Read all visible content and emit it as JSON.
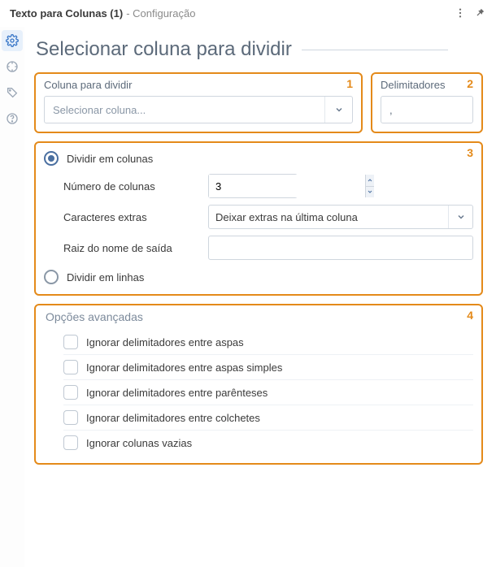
{
  "header": {
    "node_title": "Texto para Colunas (1)",
    "subtitle": "- Configuração"
  },
  "page": {
    "title": "Selecionar coluna para dividir"
  },
  "annotations": {
    "a1": "1",
    "a2": "2",
    "a3": "3",
    "a4": "4"
  },
  "col_select": {
    "label": "Coluna para dividir",
    "placeholder": "Selecionar coluna..."
  },
  "delim": {
    "label": "Delimitadores",
    "value": ","
  },
  "split": {
    "radio_cols": "Dividir em colunas",
    "radio_rows": "Dividir em linhas",
    "num_cols_label": "Número de colunas",
    "num_cols_value": "3",
    "extra_label": "Caracteres extras",
    "extra_value": "Deixar extras na última coluna",
    "root_label": "Raiz do nome de saída",
    "root_value": ""
  },
  "adv": {
    "title": "Opções avançadas",
    "opts": [
      "Ignorar delimitadores entre aspas",
      "Ignorar delimitadores entre aspas simples",
      "Ignorar delimitadores entre parênteses",
      "Ignorar delimitadores entre colchetes",
      "Ignorar colunas vazias"
    ]
  }
}
